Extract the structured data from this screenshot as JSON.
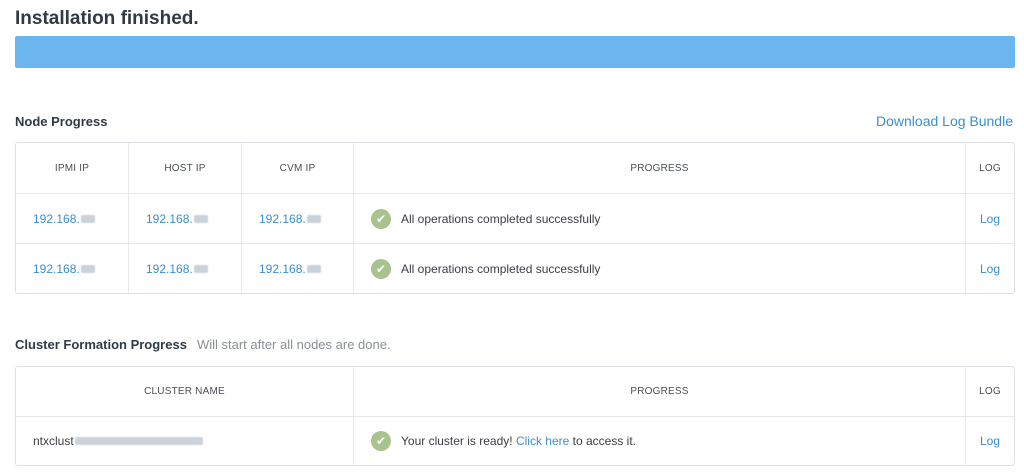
{
  "header": {
    "title": "Installation finished.",
    "progress_fraction": 1.0
  },
  "node_progress": {
    "title": "Node Progress",
    "download_link": "Download Log Bundle",
    "columns": [
      "IPMI IP",
      "HOST IP",
      "CVM IP",
      "PROGRESS",
      "LOG"
    ],
    "rows": [
      {
        "ipmi_ip": "192.168.",
        "host_ip": "192.168.",
        "cvm_ip": "192.168.",
        "status": "All operations completed successfully",
        "log": "Log"
      },
      {
        "ipmi_ip": "192.168.",
        "host_ip": "192.168.",
        "cvm_ip": "192.168.",
        "status": "All operations completed successfully",
        "log": "Log"
      }
    ]
  },
  "cluster_progress": {
    "title": "Cluster Formation Progress",
    "subtitle": "Will start after all nodes are done.",
    "columns": [
      "CLUSTER NAME",
      "PROGRESS",
      "LOG"
    ],
    "rows": [
      {
        "name": "ntxclust",
        "status_prefix": "Your cluster is ready! ",
        "status_link": "Click here",
        "status_suffix": " to access it.",
        "log": "Log"
      }
    ]
  },
  "colors": {
    "progress_fill": "#6bb6ef",
    "link": "#3a8fcc",
    "success": "#a9c38e"
  },
  "icons": {
    "success": "check-circle-icon"
  }
}
